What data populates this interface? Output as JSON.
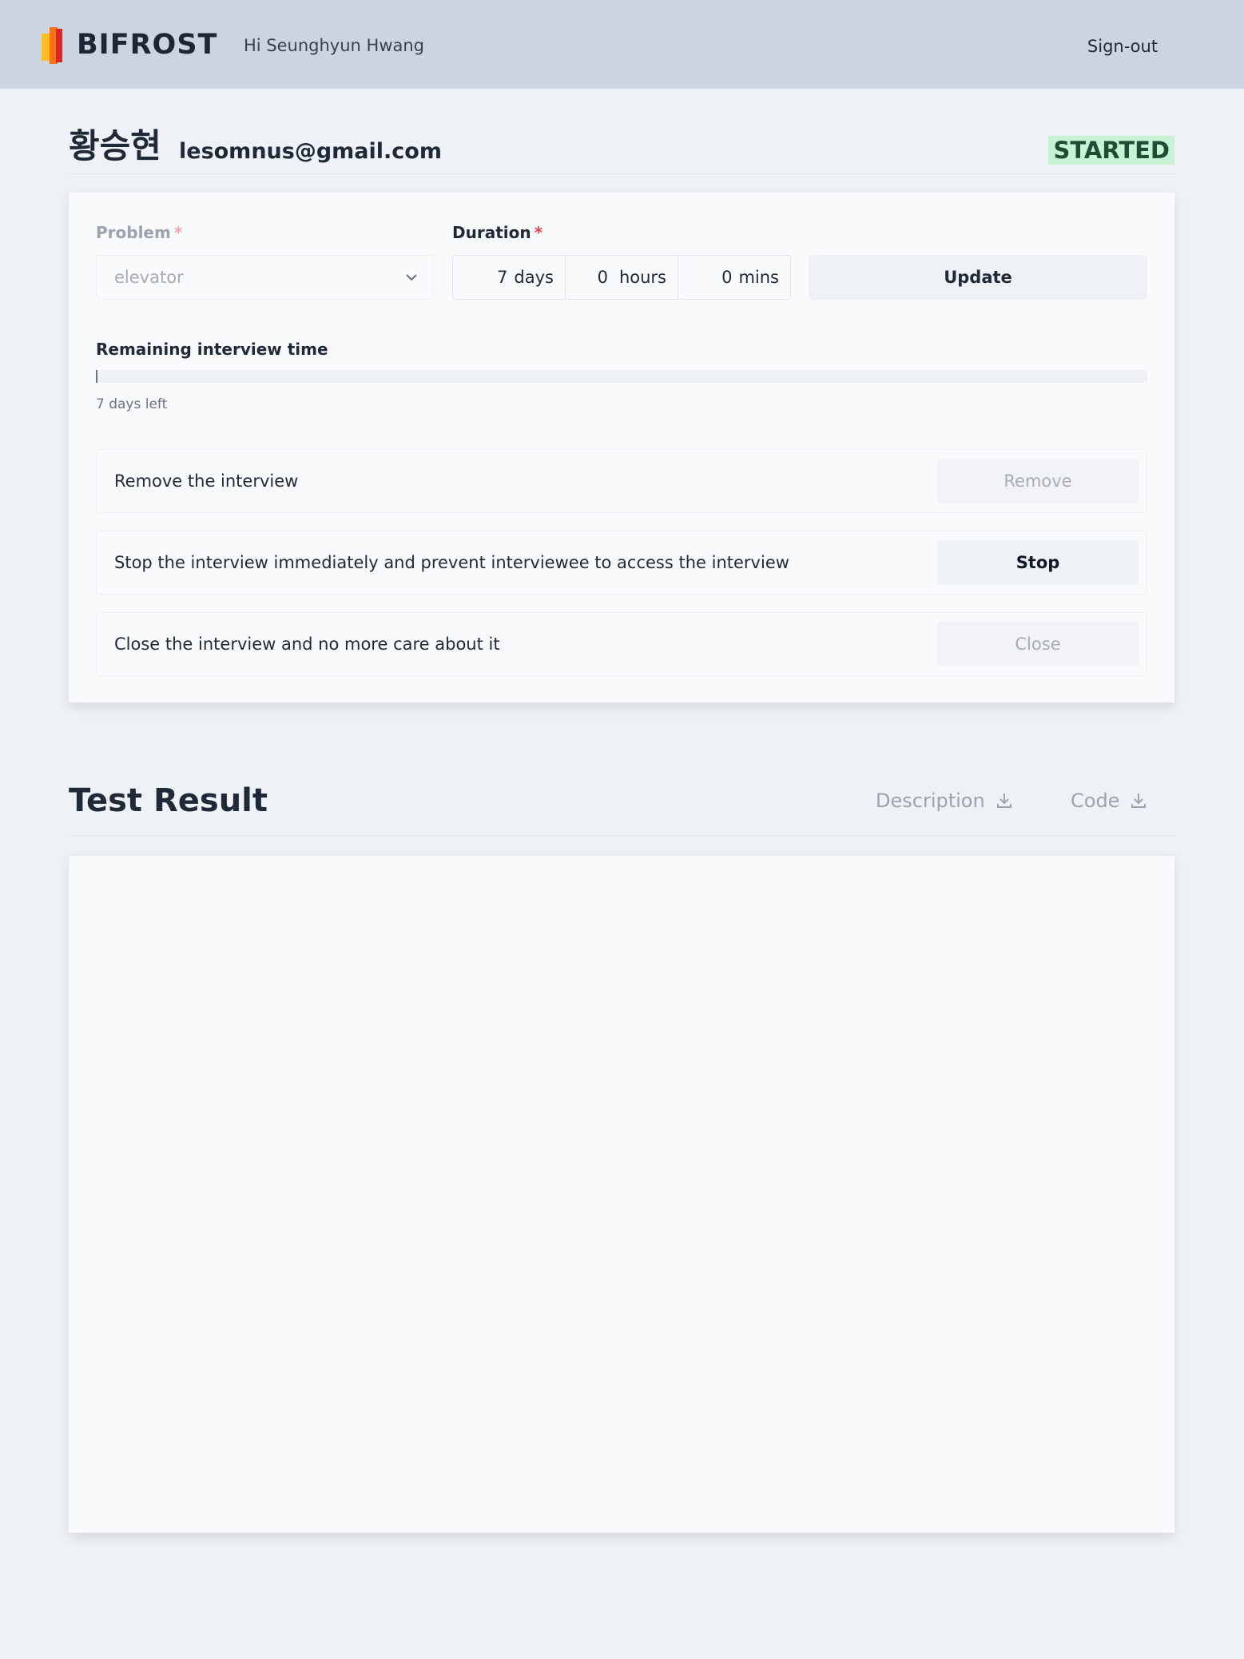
{
  "header": {
    "brand": "BIFROST",
    "greeting": "Hi Seunghyun Hwang",
    "signout_label": "Sign-out"
  },
  "candidate": {
    "name": "황승현",
    "email": "lesomnus@gmail.com",
    "status": "STARTED",
    "status_color": "#c6f3d4"
  },
  "settings": {
    "problem_label": "Problem",
    "problem_value": "elevator",
    "duration_label": "Duration",
    "required_mark": "*",
    "days_value": "7",
    "days_unit": "days",
    "hours_value": "0",
    "hours_unit": "hours",
    "mins_value": "0",
    "mins_unit": "mins",
    "update_label": "Update",
    "remaining_label": "Remaining interview time",
    "remaining_text": "7 days left",
    "remaining_fraction": 0.001
  },
  "actions": [
    {
      "text": "Remove the interview",
      "button": "Remove",
      "enabled": false
    },
    {
      "text": "Stop the interview immediately and prevent interviewee to access the interview",
      "button": "Stop",
      "enabled": true
    },
    {
      "text": "Close the interview and no more care about it",
      "button": "Close",
      "enabled": false
    }
  ],
  "result": {
    "title": "Test Result",
    "description_label": "Description",
    "code_label": "Code"
  },
  "colors": {
    "header_bg": "#cbd5df",
    "page_bg": "#eef2f6",
    "required": "#ef4444"
  }
}
